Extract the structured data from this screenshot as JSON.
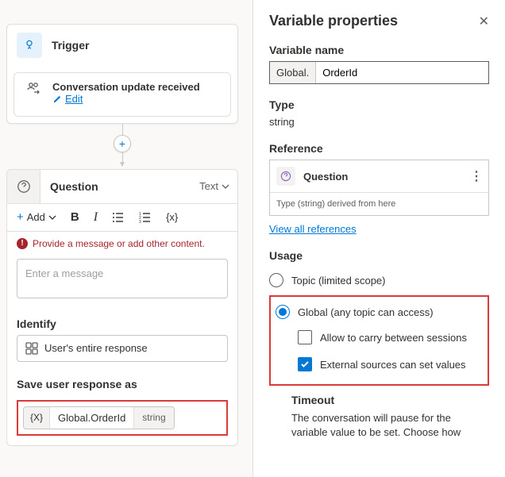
{
  "canvas": {
    "trigger": {
      "title": "Trigger",
      "event": "Conversation update received",
      "edit": "Edit"
    },
    "question": {
      "title": "Question",
      "type_label": "Text",
      "add_label": "Add",
      "error": "Provide a message or add other content.",
      "placeholder": "Enter a message",
      "identify_label": "Identify",
      "identify_value": "User's entire response",
      "save_label": "Save user response as",
      "var_fx": "{X}",
      "var_name": "Global.OrderId",
      "var_type": "string"
    }
  },
  "panel": {
    "title": "Variable properties",
    "name_label": "Variable name",
    "name_prefix": "Global.",
    "name_value": "OrderId",
    "type_label": "Type",
    "type_value": "string",
    "ref_label": "Reference",
    "ref_item": "Question",
    "ref_derived": "Type (string) derived from here",
    "view_all": "View all references",
    "usage_label": "Usage",
    "usage": {
      "topic": "Topic (limited scope)",
      "global": "Global (any topic can access)",
      "carry": "Allow to carry between sessions",
      "external": "External sources can set values"
    },
    "timeout_label": "Timeout",
    "timeout_text": "The conversation will pause for the variable value to be set. Choose how"
  }
}
